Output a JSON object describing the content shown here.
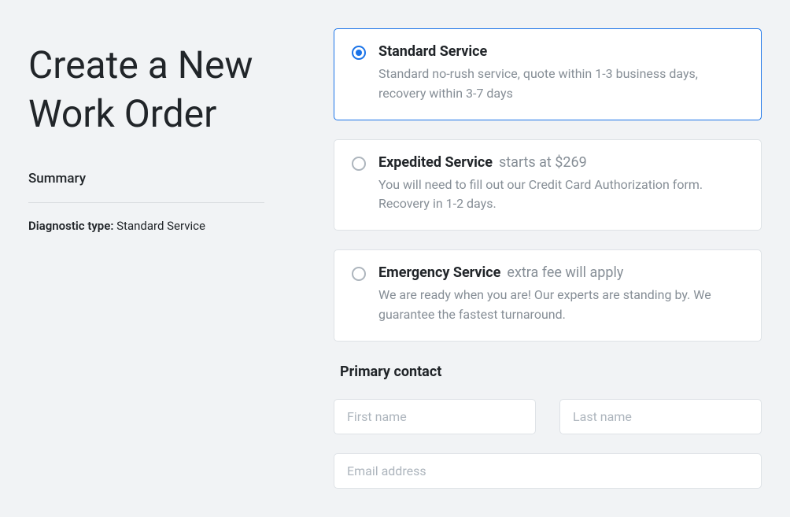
{
  "page_title": "Create a New Work Order",
  "summary": {
    "heading": "Summary",
    "diag_label": "Diagnostic type:",
    "diag_value": "Standard Service"
  },
  "options": [
    {
      "title": "Standard Service",
      "note": "",
      "desc": "Standard no-rush service, quote within 1-3 business days, recovery within 3-7 days",
      "selected": true
    },
    {
      "title": "Expedited Service",
      "note": "starts at $269",
      "desc": "You will need to fill out our Credit Card Authorization form. Recovery in 1-2 days.",
      "selected": false
    },
    {
      "title": "Emergency Service",
      "note": "extra fee will apply",
      "desc": "We are ready when you are! Our experts are standing by. We guarantee the fastest turnaround.",
      "selected": false
    }
  ],
  "contact": {
    "heading": "Primary contact",
    "first_name_placeholder": "First name",
    "last_name_placeholder": "Last name",
    "email_placeholder": "Email address",
    "first_name": "",
    "last_name": "",
    "email": ""
  }
}
